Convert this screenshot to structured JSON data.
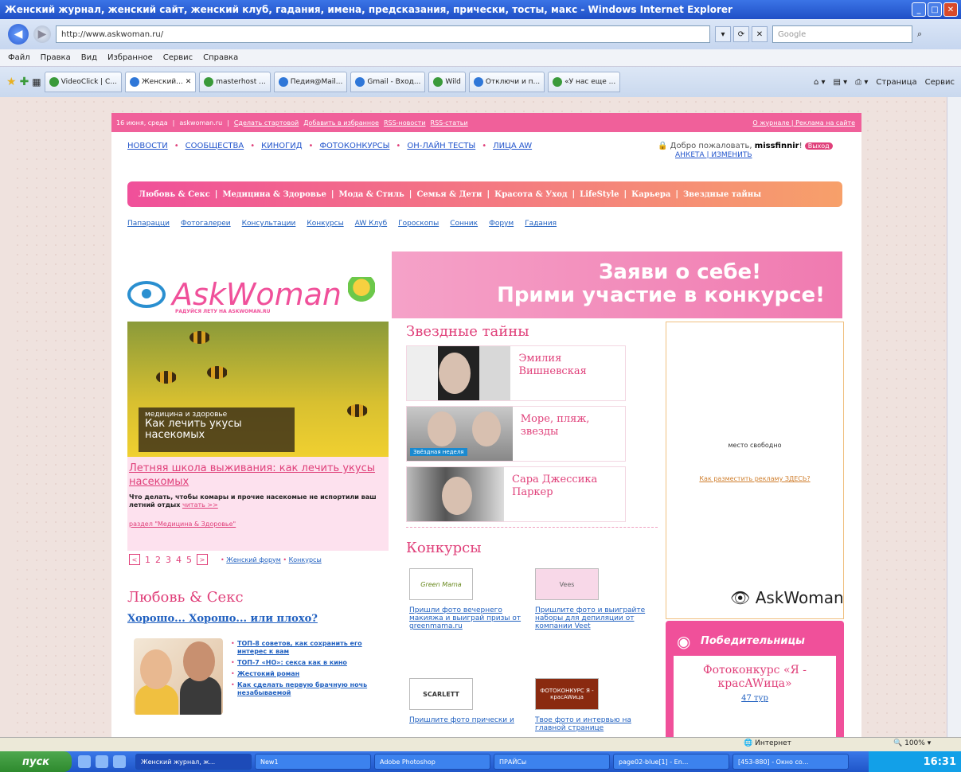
{
  "window": {
    "title": "Женский журнал, женский сайт, женский клуб, гадания, имена, предсказания, прически, тосты, макс - Windows Internet Explorer"
  },
  "browser": {
    "address": "http://www.askwoman.ru/",
    "search_placeholder": "Google",
    "menu": [
      "Файл",
      "Правка",
      "Вид",
      "Избранное",
      "Сервис",
      "Справка"
    ],
    "tabs": [
      "VideoClick | C...",
      "Женский...",
      "masterhost ...",
      "Педия@Mail...",
      "Gmail - Вход...",
      "Wild",
      "Отключи и п...",
      "«У нас еще ..."
    ],
    "tools": [
      "Страница",
      "Сервис"
    ],
    "status_zone": "Интернет",
    "zoom": "100%"
  },
  "site": {
    "topbar": {
      "date": "16 июня, среда",
      "domain": "askwoman.ru",
      "links": [
        "Сделать стартовой",
        "Добавить в избранное",
        "RSS-новости",
        "RSS-статьи"
      ],
      "right": "О журнале | Реклама на сайте"
    },
    "mainnav": [
      "НОВОСТИ",
      "СООБЩЕСТВА",
      "КИНОГИД",
      "ФОТОКОНКУРСЫ",
      "ОН-ЛАЙН ТЕСТЫ",
      "ЛИЦА AW"
    ],
    "welcome": {
      "text": "Добро пожаловать,",
      "user": "missfinnir",
      "badge": "Выход",
      "links": "АНКЕТА | ИЗМЕНИТЬ"
    },
    "categories": [
      "Любовь & Секс",
      "Медицина & Здоровье",
      "Мода & Стиль",
      "Семья & Дети",
      "Красота & Уход",
      "LifeStyle",
      "Карьера",
      "Звездные тайны"
    ],
    "subnav": [
      "Папарацци",
      "Фотогалереи",
      "Консультации",
      "Конкурсы",
      "AW Клуб",
      "Гороскопы",
      "Сонник",
      "Форум",
      "Гадания"
    ],
    "logo": {
      "name": "AskWoman",
      "tagline": "РАДУЙСЯ ЛЕТУ НА ASKWOMAN.RU"
    },
    "banner": {
      "line1": "Заяви о себе!",
      "line2": "Прими участие в конкурсе!"
    },
    "feature": {
      "rubric": "медицина и здоровье",
      "caption": "Как лечить укусы насекомых",
      "headline": "Летняя школа выживания: как лечить укусы насекомых",
      "desc": "Что делать, чтобы комары и прочие насекомые не испортили ваш летний отдых",
      "more": "читать >>",
      "section": "раздел \"Медицина & Здоровье\""
    },
    "pager": {
      "prev": "<",
      "pages": [
        "1",
        "2",
        "3",
        "4",
        "5"
      ],
      "next": ">",
      "links": [
        "Женский форум",
        "Конкурсы"
      ]
    },
    "love": {
      "heading": "Любовь & Секс",
      "question": "Хорошо... Хорошо... или плохо?",
      "links": [
        "ТОП-8 советов, как сохранить его интерес к вам",
        "ТОП-7 «НО»: секса как в кино",
        "Жестокий роман",
        "Как сделать первую брачную ночь незабываемой"
      ]
    },
    "stars": {
      "heading": "Звездные тайны",
      "items": [
        {
          "name": "Эмилия Вишневская"
        },
        {
          "name": "Море, пляж, звезды",
          "label": "Звёздная неделя"
        },
        {
          "name": "Сара Джессика Паркер"
        }
      ]
    },
    "contests": {
      "heading": "Конкурсы",
      "items": [
        {
          "thumb": "Green Mama",
          "text": "Пришли фото вечернего макияжа и выиграй призы от greenmama.ru"
        },
        {
          "thumb": "Vees",
          "text": "Пришлите фото и выиграйте наборы для депиляции от компании Veet"
        },
        {
          "thumb": "SCARLETT",
          "text": "Пришлите фото прически и"
        },
        {
          "thumb": "ФОТОКОНКУРС Я - красAWица",
          "text": "Твое фото и интервью на главной странице"
        }
      ]
    },
    "ad": {
      "free": "место свободно",
      "how": "Как разместить рекламу ЗДЕСЬ?",
      "logo": "AskWoman"
    },
    "winners": {
      "title": "Победительницы",
      "contest": "Фотоконкурс «Я - красAWица»",
      "round": "47 тур"
    }
  },
  "taskbar": {
    "start": "пуск",
    "tasks": [
      "Женский журнал, ж...",
      "New1",
      "Adobe Photoshop",
      "ПРАЙСы",
      "page02-blue[1] - En...",
      "[453-880] - Окно со..."
    ],
    "clock": "16:31"
  },
  "colors": {
    "pink": "#f0509a",
    "orange": "#f7a06a",
    "link": "#2060c0"
  }
}
